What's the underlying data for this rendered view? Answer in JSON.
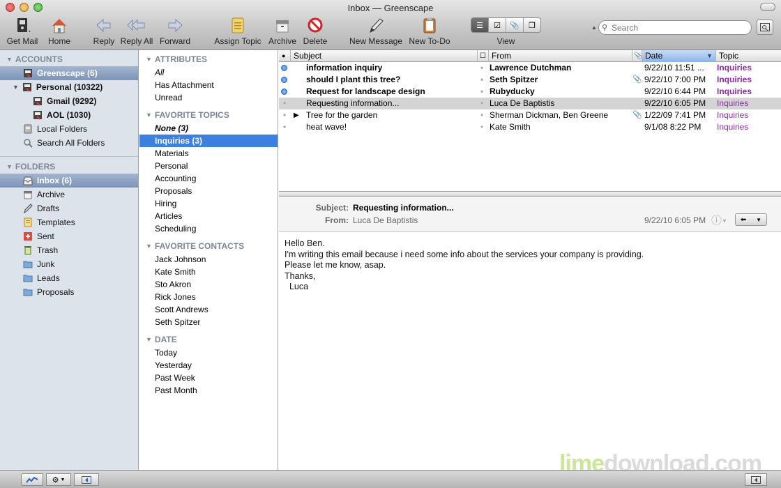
{
  "window": {
    "title": "Inbox — Greenscape"
  },
  "toolbar": {
    "get_mail": "Get Mail",
    "home": "Home",
    "reply": "Reply",
    "reply_all": "Reply All",
    "forward": "Forward",
    "assign_topic": "Assign Topic",
    "archive": "Archive",
    "delete": "Delete",
    "new_message": "New Message",
    "new_todo": "New To-Do",
    "view_label": "View",
    "search_placeholder": "Search"
  },
  "accounts": {
    "header": "ACCOUNTS",
    "items": [
      {
        "label": "Greenscape (6)"
      },
      {
        "label": "Personal (10322)"
      },
      {
        "label": "Gmail (9292)"
      },
      {
        "label": "AOL (1030)"
      },
      {
        "label": "Local Folders"
      },
      {
        "label": "Search All Folders"
      }
    ]
  },
  "folders": {
    "header": "FOLDERS",
    "items": [
      {
        "label": "Inbox (6)"
      },
      {
        "label": "Archive"
      },
      {
        "label": "Drafts"
      },
      {
        "label": "Templates"
      },
      {
        "label": "Sent"
      },
      {
        "label": "Trash"
      },
      {
        "label": "Junk"
      },
      {
        "label": "Leads"
      },
      {
        "label": "Proposals"
      }
    ]
  },
  "filters": {
    "attributes": {
      "header": "ATTRIBUTES",
      "items": [
        "All",
        "Has Attachment",
        "Unread"
      ]
    },
    "topics": {
      "header": "FAVORITE TOPICS",
      "items": [
        "None (3)",
        "Inquiries (3)",
        "Materials",
        "Personal",
        "Accounting",
        "Proposals",
        "Hiring",
        "Articles",
        "Scheduling"
      ]
    },
    "contacts": {
      "header": "FAVORITE CONTACTS",
      "items": [
        "Jack Johnson",
        "Kate Smith",
        "Sto Akron",
        "Rick Jones",
        "Scott Andrews",
        "Seth Spitzer"
      ]
    },
    "date": {
      "header": "DATE",
      "items": [
        "Today",
        "Yesterday",
        "Past Week",
        "Past Month"
      ]
    }
  },
  "message_list": {
    "columns": {
      "subject": "Subject",
      "from": "From",
      "date": "Date",
      "topic": "Topic"
    },
    "rows": [
      {
        "subject": "information inquiry",
        "from": "Lawrence Dutchman",
        "date": "9/22/10 11:51 ...",
        "topic": "Inquiries"
      },
      {
        "subject": "should I plant this tree?",
        "from": "Seth Spitzer",
        "date": "9/22/10 7:00 PM",
        "topic": "Inquiries"
      },
      {
        "subject": "Request for landscape design",
        "from": "Rubyducky",
        "date": "9/22/10 6:44 PM",
        "topic": "Inquiries"
      },
      {
        "subject": "Requesting information...",
        "from": "Luca De Baptistis",
        "date": "9/22/10 6:05 PM",
        "topic": "Inquiries"
      },
      {
        "subject": "Tree for the garden",
        "from": "Sherman Dickman, Ben Greene",
        "date": "1/22/09 7:41 PM",
        "topic": "Inquiries"
      },
      {
        "subject": "heat wave!",
        "from": "Kate Smith",
        "date": "9/1/08 8:22 PM",
        "topic": "Inquiries"
      }
    ]
  },
  "preview": {
    "subject_label": "Subject:",
    "subject": "Requesting information...",
    "from_label": "From:",
    "from": "Luca De Baptistis",
    "date": "9/22/10 6:05 PM",
    "body": [
      "Hello Ben.",
      "I'm writing this email because i need some info about the services your company is providing.",
      "Please let me know, asap.",
      "Thanks,",
      "  Luca"
    ]
  },
  "watermark": {
    "part1": "lime",
    "part2": "download.com"
  },
  "colors": {
    "selection": "#3d80df",
    "topic": "#8c2aa8",
    "sidebar": "#dde3ea",
    "unread_dot": "#3a7fd6"
  }
}
